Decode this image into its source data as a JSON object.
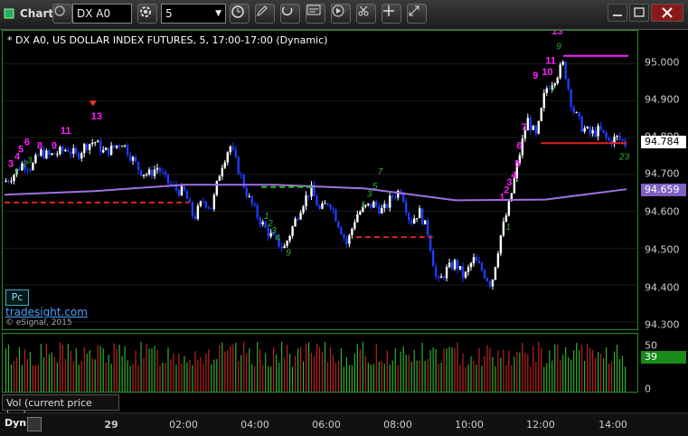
{
  "toolbar": {
    "chart_label": "Chart",
    "symbol": "DX A0",
    "interval": "5"
  },
  "chart": {
    "title": "* DX A0, US DOLLAR INDEX FUTURES, 5, 17:00-17:00 (Dynamic)",
    "price_labels": [
      "95.000",
      "94.900",
      "94.800",
      "94.700",
      "94.600",
      "94.500",
      "94.400",
      "94.300"
    ],
    "last_price": "94.784",
    "ma_price": "94.659",
    "pc_label": "Pc",
    "link_text": "tradesight.com",
    "copyright": "© eSignal, 2015"
  },
  "volume": {
    "tab_label": "Vol (current price bar)",
    "axis_labels": [
      "50",
      "0"
    ],
    "current": "39"
  },
  "time_axis": {
    "corner_label": "Dyn",
    "labels": [
      "29",
      "02:00",
      "04:00",
      "06:00",
      "08:00",
      "10:00",
      "12:00",
      "14:00"
    ]
  },
  "colors": {
    "up_bar": "#ffffff",
    "down_bar": "#1e3cff",
    "ma_line": "#a070e0",
    "support": "#e02020",
    "counter_magenta": "#ff20ff",
    "counter_green": "#30b030"
  },
  "chart_data": {
    "type": "candlestick",
    "title": "* DX A0, US DOLLAR INDEX FUTURES, 5, 17:00-17:00 (Dynamic)",
    "ylim": [
      94.28,
      95.09
    ],
    "x_ticks": [
      "29",
      "02:00",
      "04:00",
      "06:00",
      "08:00",
      "10:00",
      "12:00",
      "14:00"
    ],
    "price_path": [
      [
        0,
        94.68
      ],
      [
        10,
        94.7
      ],
      [
        20,
        94.73
      ],
      [
        30,
        94.72
      ],
      [
        40,
        94.76
      ],
      [
        50,
        94.75
      ],
      [
        60,
        94.76
      ],
      [
        70,
        94.77
      ],
      [
        80,
        94.75
      ],
      [
        90,
        94.78
      ],
      [
        100,
        94.79
      ],
      [
        110,
        94.76
      ],
      [
        120,
        94.77
      ],
      [
        130,
        94.79
      ],
      [
        140,
        94.75
      ],
      [
        150,
        94.71
      ],
      [
        160,
        94.7
      ],
      [
        170,
        94.72
      ],
      [
        180,
        94.68
      ],
      [
        190,
        94.66
      ],
      [
        200,
        94.65
      ],
      [
        210,
        94.58
      ],
      [
        220,
        94.63
      ],
      [
        230,
        94.61
      ],
      [
        240,
        94.72
      ],
      [
        250,
        94.78
      ],
      [
        260,
        94.71
      ],
      [
        270,
        94.64
      ],
      [
        280,
        94.59
      ],
      [
        290,
        94.55
      ],
      [
        300,
        94.52
      ],
      [
        310,
        94.5
      ],
      [
        320,
        94.56
      ],
      [
        330,
        94.62
      ],
      [
        340,
        94.66
      ],
      [
        350,
        94.6
      ],
      [
        360,
        94.63
      ],
      [
        370,
        94.57
      ],
      [
        380,
        94.51
      ],
      [
        390,
        94.59
      ],
      [
        400,
        94.61
      ],
      [
        410,
        94.62
      ],
      [
        420,
        94.6
      ],
      [
        430,
        94.64
      ],
      [
        440,
        94.66
      ],
      [
        450,
        94.57
      ],
      [
        460,
        94.6
      ],
      [
        470,
        94.54
      ],
      [
        480,
        94.4
      ],
      [
        490,
        94.44
      ],
      [
        500,
        94.46
      ],
      [
        510,
        94.42
      ],
      [
        520,
        94.47
      ],
      [
        530,
        94.44
      ],
      [
        540,
        94.4
      ],
      [
        550,
        94.53
      ],
      [
        560,
        94.62
      ],
      [
        570,
        94.74
      ],
      [
        580,
        94.85
      ],
      [
        590,
        94.8
      ],
      [
        600,
        94.93
      ],
      [
        610,
        94.96
      ],
      [
        620,
        95.0
      ],
      [
        630,
        94.88
      ],
      [
        640,
        94.83
      ],
      [
        650,
        94.81
      ],
      [
        660,
        94.82
      ],
      [
        670,
        94.79
      ],
      [
        680,
        94.8
      ],
      [
        690,
        94.78
      ]
    ],
    "moving_average": [
      [
        0,
        94.645
      ],
      [
        100,
        94.655
      ],
      [
        200,
        94.672
      ],
      [
        300,
        94.672
      ],
      [
        400,
        94.662
      ],
      [
        500,
        94.63
      ],
      [
        600,
        94.632
      ],
      [
        690,
        94.66
      ]
    ],
    "horizontal_levels": [
      {
        "from": 0,
        "to": 205,
        "price": 94.624,
        "color": "#e02020",
        "style": "dashed"
      },
      {
        "from": 285,
        "to": 345,
        "price": 94.666,
        "color": "#20c020",
        "style": "dashed"
      },
      {
        "from": 390,
        "to": 475,
        "price": 94.53,
        "color": "#e02020",
        "style": "dashed"
      },
      {
        "from": 595,
        "to": 690,
        "price": 94.785,
        "color": "#e02020",
        "style": "solid"
      },
      {
        "from": 620,
        "to": 692,
        "price": 95.022,
        "color": "#ff20ff",
        "style": "solid"
      }
    ],
    "counters_magenta": [
      {
        "t": 4,
        "p": 94.72,
        "text": "3"
      },
      {
        "t": 11,
        "p": 94.74,
        "text": "4"
      },
      {
        "t": 15,
        "p": 94.76,
        "text": "5"
      },
      {
        "t": 22,
        "p": 94.78,
        "text": "6"
      },
      {
        "t": 36,
        "p": 94.77,
        "text": "8"
      },
      {
        "t": 52,
        "p": 94.77,
        "text": "9"
      },
      {
        "t": 62,
        "p": 94.81,
        "text": "11"
      },
      {
        "t": 96,
        "p": 94.85,
        "text": "13"
      },
      {
        "t": 549,
        "p": 94.63,
        "text": "1"
      },
      {
        "t": 554,
        "p": 94.65,
        "text": "2"
      },
      {
        "t": 557,
        "p": 94.67,
        "text": "3"
      },
      {
        "t": 562,
        "p": 94.69,
        "text": "4"
      },
      {
        "t": 566,
        "p": 94.72,
        "text": "5"
      },
      {
        "t": 568,
        "p": 94.77,
        "text": "6"
      },
      {
        "t": 573,
        "p": 94.82,
        "text": "7"
      },
      {
        "t": 586,
        "p": 94.96,
        "text": "9"
      },
      {
        "t": 596,
        "p": 94.97,
        "text": "10"
      },
      {
        "t": 600,
        "p": 95.0,
        "text": "11"
      },
      {
        "t": 607,
        "p": 95.08,
        "text": "13"
      }
    ],
    "counters_green": [
      {
        "t": 10,
        "p": 94.7,
        "text": "1"
      },
      {
        "t": 20,
        "p": 94.72,
        "text": "2"
      },
      {
        "t": 25,
        "p": 94.73,
        "text": "3"
      },
      {
        "t": 288,
        "p": 94.58,
        "text": "1"
      },
      {
        "t": 292,
        "p": 94.56,
        "text": "2"
      },
      {
        "t": 296,
        "p": 94.54,
        "text": "3"
      },
      {
        "t": 300,
        "p": 94.52,
        "text": "4"
      },
      {
        "t": 312,
        "p": 94.48,
        "text": "9"
      },
      {
        "t": 395,
        "p": 94.61,
        "text": "1"
      },
      {
        "t": 402,
        "p": 94.64,
        "text": "3"
      },
      {
        "t": 408,
        "p": 94.66,
        "text": "5"
      },
      {
        "t": 414,
        "p": 94.7,
        "text": "7"
      },
      {
        "t": 556,
        "p": 94.55,
        "text": "1"
      },
      {
        "t": 605,
        "p": 94.92,
        "text": "7"
      },
      {
        "t": 612,
        "p": 95.04,
        "text": "9"
      },
      {
        "t": 682,
        "p": 94.74,
        "text": "23"
      }
    ],
    "down_arrows": [
      {
        "t": 98,
        "p": 94.9
      },
      {
        "t": 608,
        "p": 95.12
      }
    ]
  }
}
